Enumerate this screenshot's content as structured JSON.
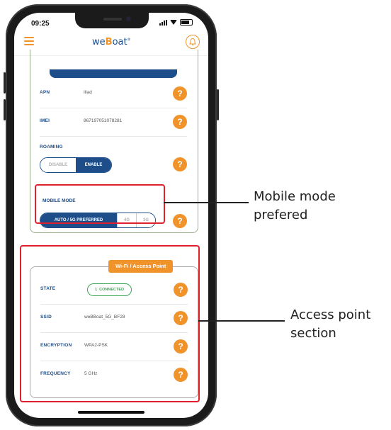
{
  "status_bar": {
    "time": "09:25"
  },
  "header": {
    "logo_prefix": "we",
    "logo_accent": "B",
    "logo_suffix": "oat",
    "logo_mark": "®"
  },
  "cellular": {
    "apn": {
      "label": "APN",
      "value": "Iliad"
    },
    "imei": {
      "label": "IMEI",
      "value": "867197051078281"
    },
    "roaming": {
      "label": "ROAMING",
      "options": [
        "DISABLE",
        "ENABLE"
      ],
      "selected": "ENABLE"
    },
    "mobile_mode": {
      "label": "MOBILE MODE",
      "options": [
        "AUTO / 5G PREFERRED",
        "4G",
        "3G"
      ],
      "selected": "AUTO / 5G PREFERRED"
    }
  },
  "access_point": {
    "title": "Wi-Fi / Access Point",
    "state": {
      "label": "STATE",
      "badge_count": "1",
      "badge_text": "CONNECTED"
    },
    "ssid": {
      "label": "SSID",
      "value": "weBBoat_5G_BF28"
    },
    "encryption": {
      "label": "ENCRYPTION",
      "value": "WPA2-PSK"
    },
    "frequency": {
      "label": "FREQUENCY",
      "value": "5 GHz"
    }
  },
  "help_glyph": "?",
  "annotations": {
    "mobile_mode": {
      "line1": "Mobile mode",
      "line2": "prefered"
    },
    "access_point": {
      "line1": "Access point",
      "line2": "section"
    }
  },
  "colors": {
    "brand_blue": "#1d4e89",
    "accent_orange": "#f0932b",
    "connected_green": "#3aa655",
    "highlight_red": "#e0202b"
  }
}
